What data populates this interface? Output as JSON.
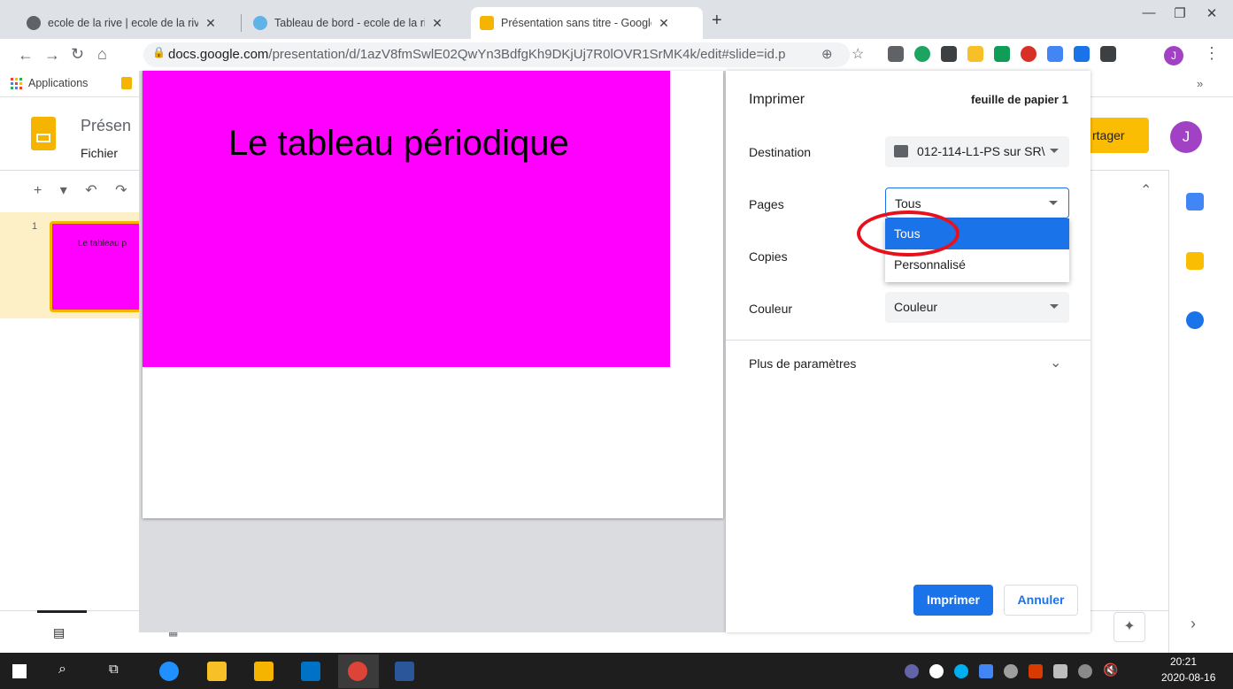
{
  "browser": {
    "tabs": [
      {
        "title": "ecole de la rive | ecole de la rive",
        "close": "✕"
      },
      {
        "title": "Tableau de bord - ecole de la rive",
        "close": "✕"
      },
      {
        "title": "Présentation sans titre - Google S",
        "close": "✕"
      }
    ],
    "new_tab": "+",
    "window": {
      "minimize": "—",
      "restore": "❐",
      "close": "✕"
    },
    "url_host": "docs.google.com",
    "url_path": "/presentation/d/1azV8fmSwlE02QwYn3BdfgKh9DKjUj7R0lOVR1SrMK4k/edit#slide=id.p",
    "bookmarks": {
      "apps_label": "Applications",
      "more": "»"
    },
    "profile_initial": "J"
  },
  "slides_app": {
    "doc_title": "Présen",
    "menu_file": "Fichier",
    "share_label": "rtager",
    "avatar_initial": "J",
    "slide_number": "1",
    "thumb_text": "Le tableau p",
    "tools": "+ ▾ ↶ ↷"
  },
  "print_preview": {
    "slide_title": "Le tableau périodique"
  },
  "print_dialog": {
    "title": "Imprimer",
    "sheet_count": "feuille de papier 1",
    "destination_label": "Destination",
    "destination_value": "012-114-L1-PS sur SR\\",
    "pages_label": "Pages",
    "pages_value": "Tous",
    "pages_options": [
      "Tous",
      "Personnalisé"
    ],
    "copies_label": "Copies",
    "color_label": "Couleur",
    "color_value": "Couleur",
    "more_settings": "Plus de paramètres",
    "print_button": "Imprimer",
    "cancel_button": "Annuler"
  },
  "taskbar": {
    "time": "20:21",
    "date": "2020-08-16"
  },
  "colors": {
    "slide_magenta": "#ff00ff",
    "accent_blue": "#1a73e8",
    "highlight_red": "#e8101a",
    "slides_yellow": "#f4b400"
  }
}
